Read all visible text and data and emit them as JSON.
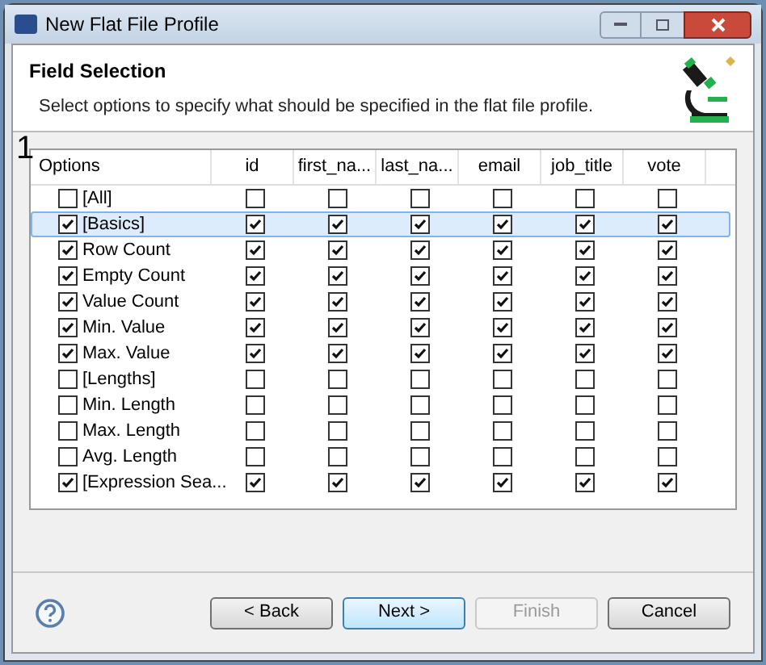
{
  "window": {
    "title": "New Flat File Profile"
  },
  "header": {
    "title": "Field Selection",
    "description": "Select options to specify what should be specified in the flat file profile."
  },
  "marker": "1",
  "table": {
    "columns": [
      "Options",
      "id",
      "first_na...",
      "last_na...",
      "email",
      "job_title",
      "vote"
    ],
    "rows": [
      {
        "label": "[All]",
        "checked": false,
        "selected": false,
        "cells": [
          false,
          false,
          false,
          false,
          false,
          false
        ]
      },
      {
        "label": "[Basics]",
        "checked": true,
        "selected": true,
        "cells": [
          true,
          true,
          true,
          true,
          true,
          true
        ]
      },
      {
        "label": "Row Count",
        "checked": true,
        "selected": false,
        "cells": [
          true,
          true,
          true,
          true,
          true,
          true
        ]
      },
      {
        "label": "Empty Count",
        "checked": true,
        "selected": false,
        "cells": [
          true,
          true,
          true,
          true,
          true,
          true
        ]
      },
      {
        "label": "Value Count",
        "checked": true,
        "selected": false,
        "cells": [
          true,
          true,
          true,
          true,
          true,
          true
        ]
      },
      {
        "label": "Min. Value",
        "checked": true,
        "selected": false,
        "cells": [
          true,
          true,
          true,
          true,
          true,
          true
        ]
      },
      {
        "label": "Max. Value",
        "checked": true,
        "selected": false,
        "cells": [
          true,
          true,
          true,
          true,
          true,
          true
        ]
      },
      {
        "label": "[Lengths]",
        "checked": false,
        "selected": false,
        "cells": [
          false,
          false,
          false,
          false,
          false,
          false
        ]
      },
      {
        "label": "Min. Length",
        "checked": false,
        "selected": false,
        "cells": [
          false,
          false,
          false,
          false,
          false,
          false
        ]
      },
      {
        "label": "Max. Length",
        "checked": false,
        "selected": false,
        "cells": [
          false,
          false,
          false,
          false,
          false,
          false
        ]
      },
      {
        "label": "Avg. Length",
        "checked": false,
        "selected": false,
        "cells": [
          false,
          false,
          false,
          false,
          false,
          false
        ]
      },
      {
        "label": "[Expression Sea...",
        "checked": true,
        "selected": false,
        "cells": [
          true,
          true,
          true,
          true,
          true,
          true
        ]
      }
    ]
  },
  "buttons": [
    {
      "label": "< Back",
      "disabled": false,
      "default": false
    },
    {
      "label": "Next >",
      "disabled": false,
      "default": true
    },
    {
      "label": "Finish",
      "disabled": true,
      "default": false
    },
    {
      "label": "Cancel",
      "disabled": false,
      "default": false
    }
  ]
}
